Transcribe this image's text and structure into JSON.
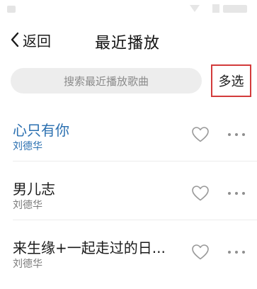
{
  "nav": {
    "back_label": "返回",
    "title": "最近播放"
  },
  "search": {
    "placeholder": "搜索最近播放歌曲"
  },
  "toolbar": {
    "multi_select_label": "多选",
    "highlight_color": "#d33b3b"
  },
  "songs": [
    {
      "title": "心只有你",
      "artist": "刘德华",
      "playing": true
    },
    {
      "title": "男儿志",
      "artist": "刘德华",
      "playing": false
    },
    {
      "title": "来生缘+一起走过的日...",
      "artist": "刘德华",
      "playing": false
    }
  ],
  "icons": {
    "back": "chevron-left-icon",
    "like": "heart-icon",
    "more": "more-dots-icon"
  },
  "colors": {
    "playing_accent": "#2a6fb0",
    "secondary_text": "#7a7a7a"
  }
}
